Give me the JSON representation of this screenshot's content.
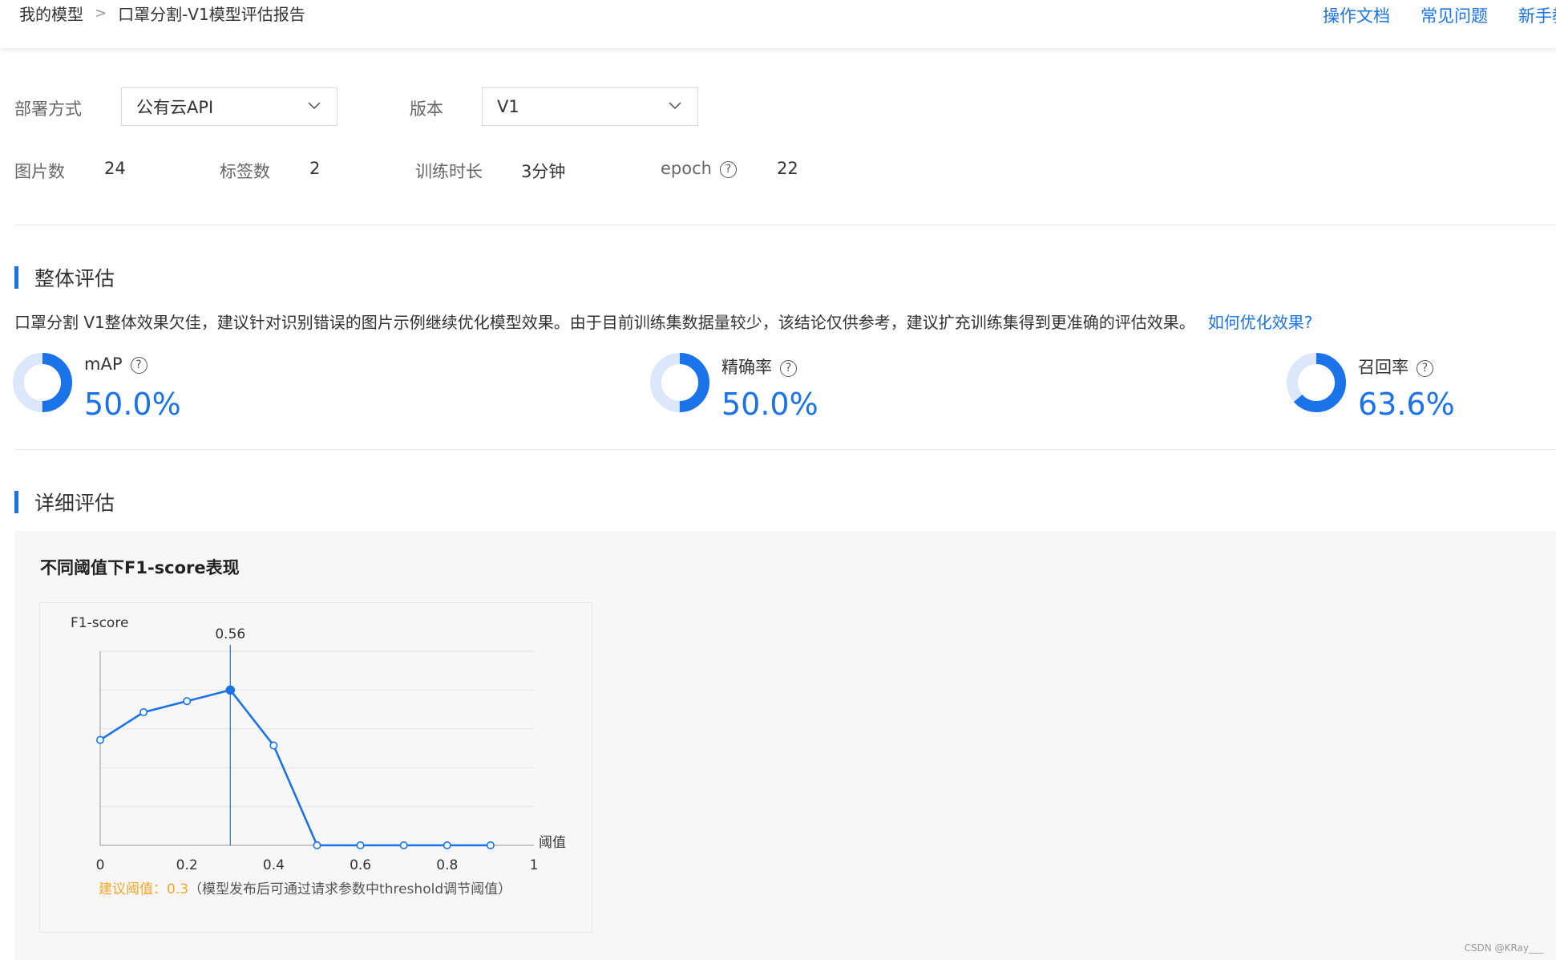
{
  "breadcrumb": {
    "root": "我的模型",
    "separator": ">",
    "current": "口罩分割-V1模型评估报告"
  },
  "top_links": [
    "操作文档",
    "常见问题",
    "新手教程"
  ],
  "selectors": {
    "deploy_label": "部署方式",
    "deploy_value": "公有云API",
    "version_label": "版本",
    "version_value": "V1"
  },
  "stats": {
    "images_label": "图片数",
    "images_value": "24",
    "tags_label": "标签数",
    "tags_value": "2",
    "duration_label": "训练时长",
    "duration_value": "3分钟",
    "epoch_label": "epoch",
    "epoch_value": "22"
  },
  "overall": {
    "title": "整体评估",
    "summary": "口罩分割 V1整体效果欠佳，建议针对识别错误的图片示例继续优化模型效果。由于目前训练集数据量较少，该结论仅供参考，建议扩充训练集得到更准确的评估效果。",
    "link": "如何优化效果?",
    "metrics": [
      {
        "name": "mAP",
        "value": "50.0%",
        "fraction": 0.5
      },
      {
        "name": "精确率",
        "value": "50.0%",
        "fraction": 0.5
      },
      {
        "name": "召回率",
        "value": "63.6%",
        "fraction": 0.636
      }
    ]
  },
  "detail": {
    "title": "详细评估",
    "chart_title": "不同阈值下F1-score表现",
    "suggest_label": "建议阈值：",
    "suggest_value": "0.3",
    "suggest_note": "（模型发布后可通过请求参数中threshold调节阈值）"
  },
  "watermark": "CSDN @KRay___",
  "colors": {
    "accent": "#1a73e8",
    "donut_bg": "#dce7fb",
    "warning": "#f5a623"
  },
  "chart_data": {
    "type": "line",
    "ylabel": "F1-score",
    "xlabel": "阈值",
    "xlim": [
      0,
      1
    ],
    "ylim": [
      0,
      0.7
    ],
    "xticks": [
      "0",
      "0.2",
      "0.4",
      "0.6",
      "0.8",
      "1"
    ],
    "x": [
      0,
      0.1,
      0.2,
      0.3,
      0.4,
      0.5,
      0.6,
      0.7,
      0.8,
      0.9
    ],
    "y": [
      0.38,
      0.48,
      0.52,
      0.56,
      0.36,
      0,
      0,
      0,
      0,
      0
    ],
    "highlight": {
      "x": 0.3,
      "label": "0.56"
    },
    "grid": true
  }
}
